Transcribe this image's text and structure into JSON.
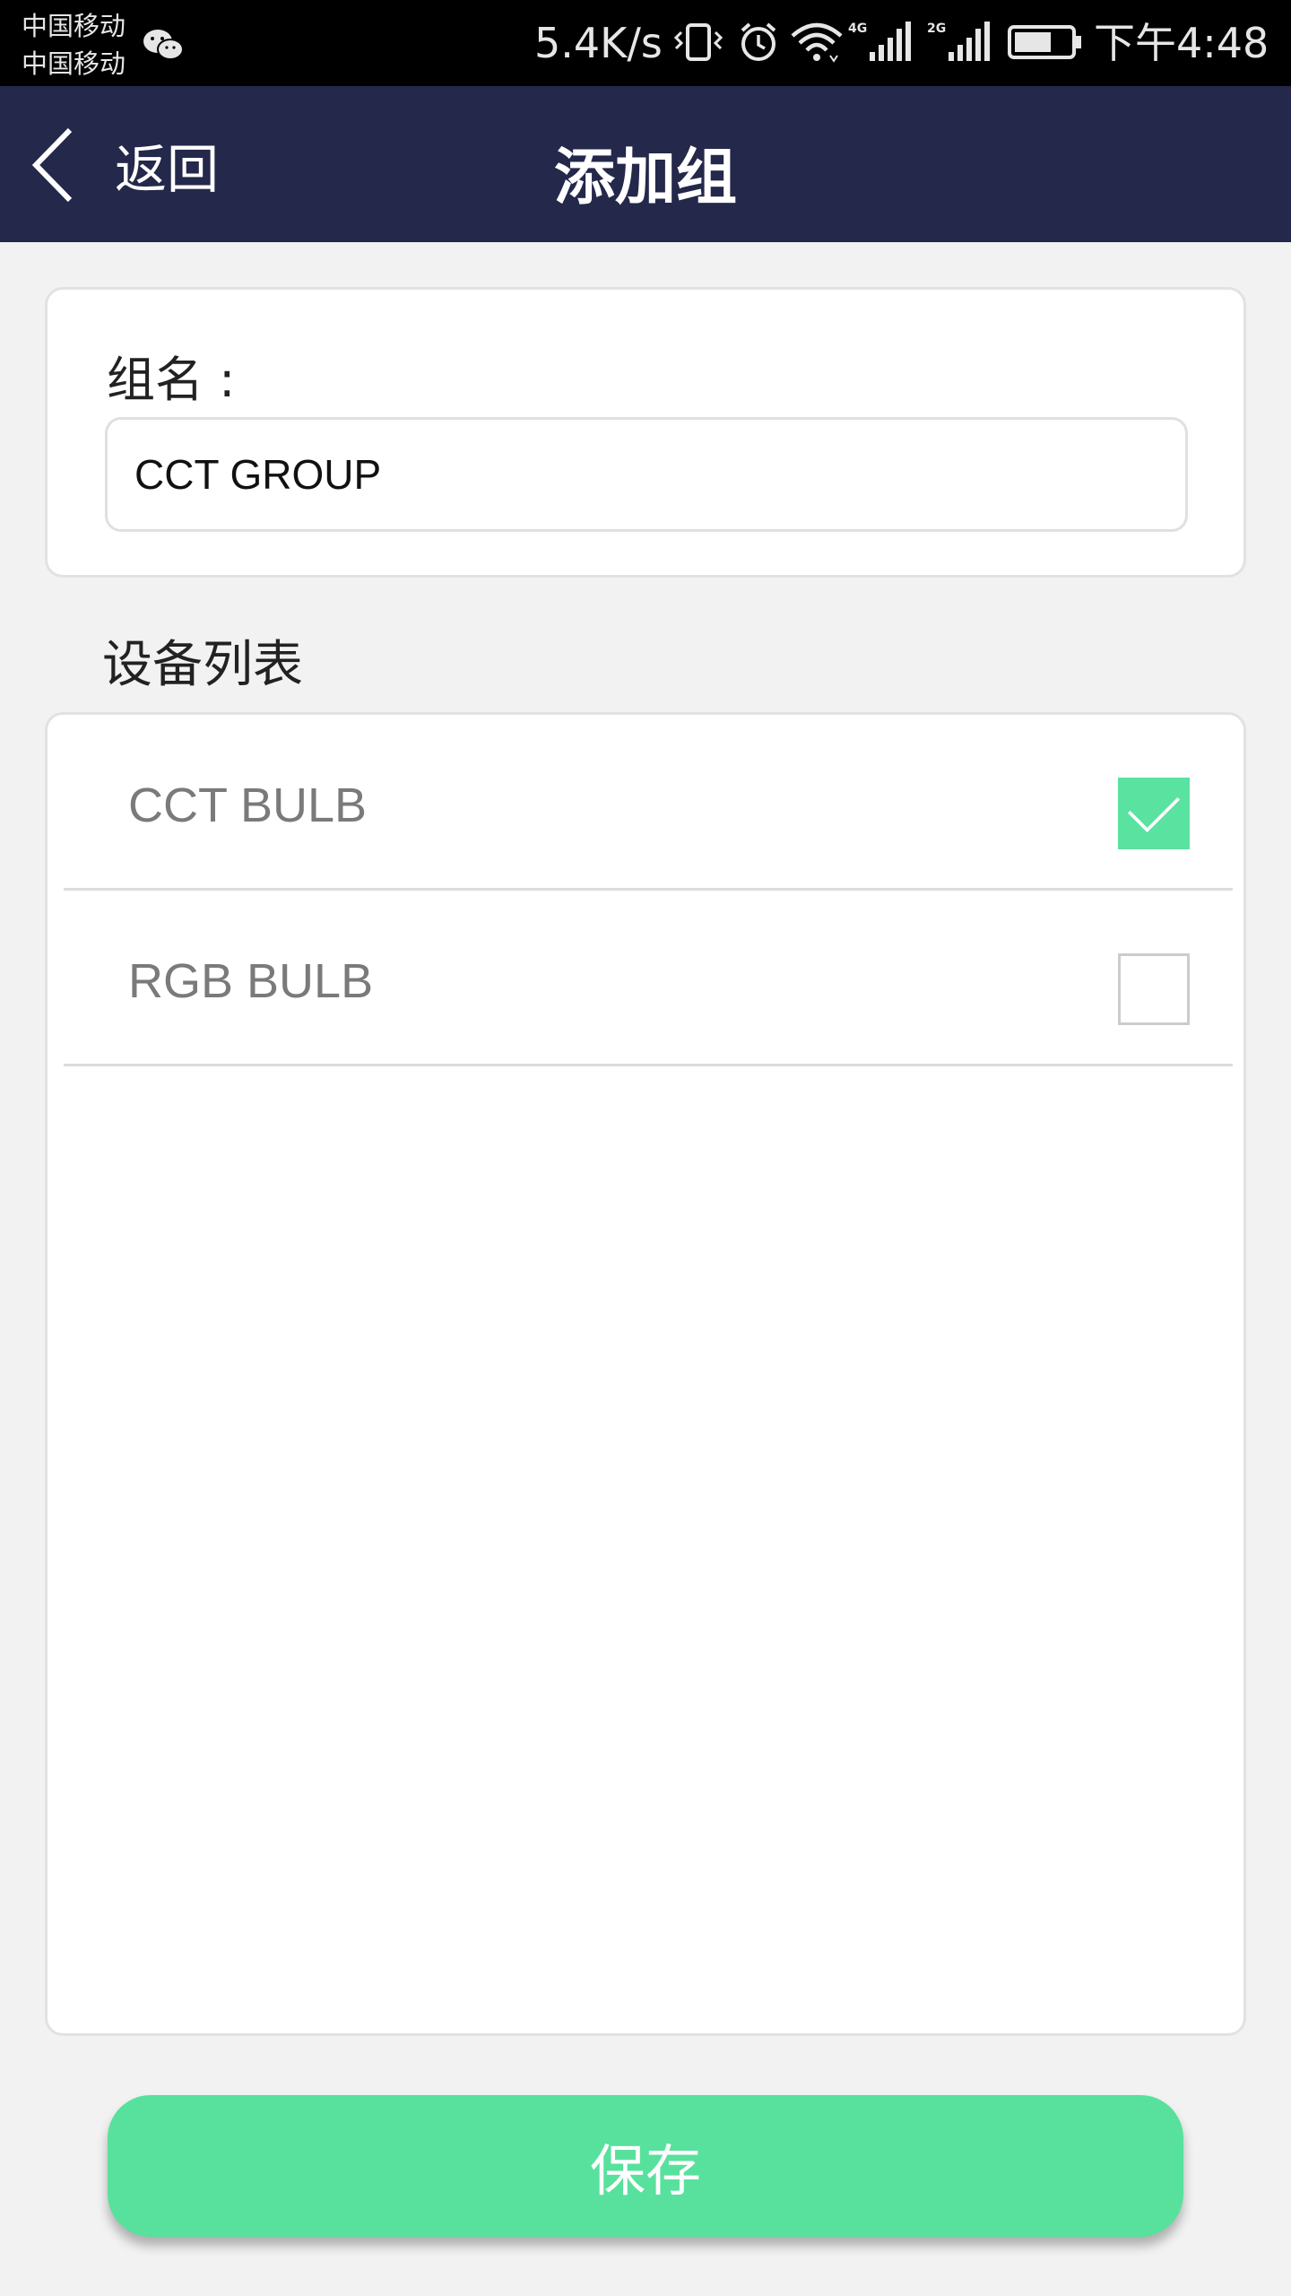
{
  "status_bar": {
    "carrier_1": "中国移动",
    "carrier_2": "中国移动",
    "network_speed": "5.4K/s",
    "time": "下午4:48",
    "icons": [
      "wechat-icon",
      "vibrate-icon",
      "alarm-icon",
      "wifi-icon",
      "signal-4g-icon",
      "signal-2g-icon",
      "battery-icon"
    ],
    "signal_1_tag": "4G",
    "signal_2_tag": "2G"
  },
  "nav": {
    "back_label": "返回",
    "title": "添加组",
    "background": "#24284a"
  },
  "group": {
    "label": "组名 :",
    "input_value": "CCT GROUP"
  },
  "devices": {
    "section_title": "设备列表",
    "items": [
      {
        "name": "CCT BULB",
        "checked": true
      },
      {
        "name": "RGB BULB",
        "checked": false
      }
    ]
  },
  "actions": {
    "save_label": "保存",
    "accent": "#58e19c"
  }
}
